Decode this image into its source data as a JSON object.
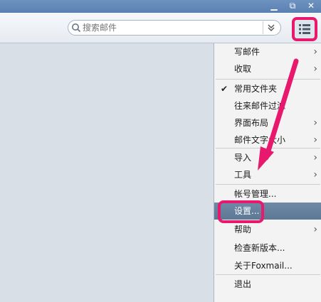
{
  "window": {
    "minimize_icon": "minimize-icon",
    "restore_icon": "restore-icon",
    "close_icon": "close-icon"
  },
  "search": {
    "placeholder": "搜索邮件",
    "options_icon": "double-chevron-down-icon"
  },
  "main_menu_icon": "list-menu-icon",
  "menu": {
    "items": [
      {
        "label": "写邮件",
        "submenu": true
      },
      {
        "label": "收取",
        "submenu": true
      },
      {
        "label": "常用文件夹",
        "checked": true
      },
      {
        "label": "往来邮件过滤"
      },
      {
        "label": "界面布局",
        "submenu": true
      },
      {
        "label": "邮件文字大小",
        "submenu": true
      },
      {
        "label": "导入",
        "submenu": true
      },
      {
        "label": "工具",
        "submenu": true
      },
      {
        "label": "帐号管理..."
      },
      {
        "label": "设置...",
        "selected": true
      },
      {
        "label": "帮助",
        "submenu": true
      },
      {
        "label": "检查新版本..."
      },
      {
        "label": "关于Foxmail..."
      },
      {
        "label": "退出"
      }
    ]
  },
  "annotation_color": "#e8196d",
  "highlight_color": "#6f89a6"
}
